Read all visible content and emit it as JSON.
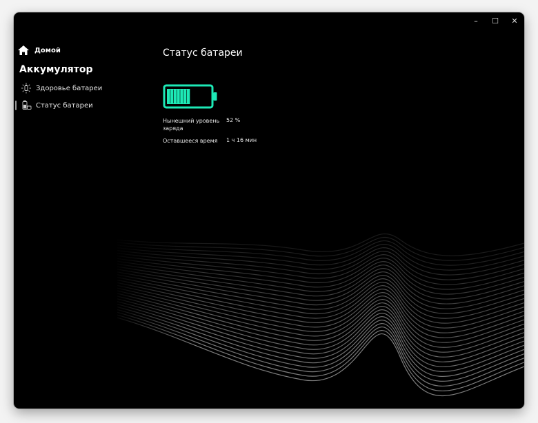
{
  "window": {
    "controls": {
      "minimize": "–",
      "maximize": "☐",
      "close": "✕"
    }
  },
  "sidebar": {
    "home": {
      "label": "Домой",
      "icon": "home-icon"
    },
    "section_title": "Аккумулятор",
    "items": [
      {
        "label": "Здоровье батареи",
        "icon": "battery-health-icon",
        "active": false
      },
      {
        "label": "Статус батареи",
        "icon": "battery-status-icon",
        "active": true
      }
    ]
  },
  "main": {
    "title": "Статус батареи",
    "battery": {
      "level_fraction": 0.52,
      "color": "#1de9b6"
    },
    "info": [
      {
        "label": "Нынешний уровень заряда",
        "value": "52 %"
      },
      {
        "label": "Оставшееся время",
        "value": "1 ч 16 мин"
      }
    ]
  },
  "colors": {
    "background": "#000000",
    "accent": "#1de9b6",
    "text": "#ffffff"
  }
}
